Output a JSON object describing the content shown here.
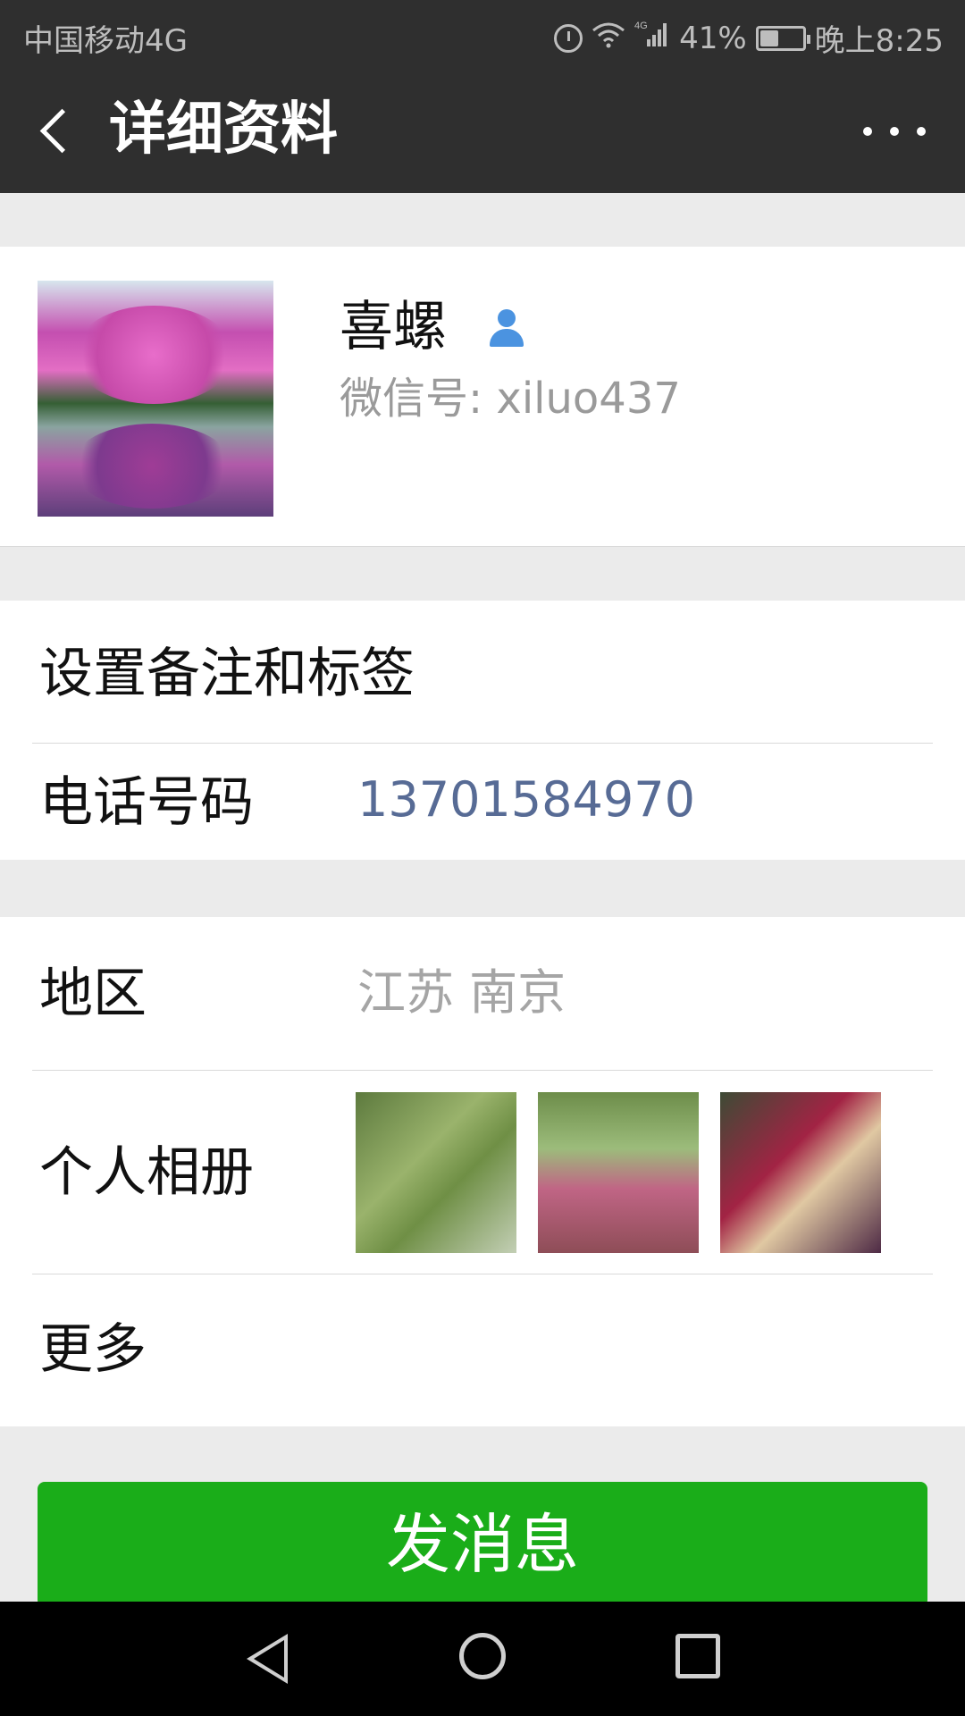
{
  "status_bar": {
    "carrier": "中国移动4G",
    "network": "4G",
    "battery": "41%",
    "battery_level": 0.41,
    "time": "晚上8:25",
    "icons": [
      "alarm-icon",
      "wifi-icon",
      "signal-icon",
      "battery-icon"
    ]
  },
  "nav": {
    "title": "详细资料",
    "back_icon": "back-icon",
    "more_icon": "more-icon"
  },
  "profile": {
    "nickname": "喜螺",
    "wechat_id_label": "微信号: xiluo437",
    "avatar_icon": "avatar",
    "contact_badge": "contact-icon"
  },
  "section1": {
    "remark_label": "设置备注和标签",
    "phone_label": "电话号码",
    "phone_value": "13701584970"
  },
  "section2": {
    "region_label": "地区",
    "region_value": "江苏  南京",
    "album_label": "个人相册",
    "more_label": "更多"
  },
  "actions": {
    "send_message": "发消息"
  },
  "colors": {
    "header": "#2f2f2f",
    "accent_green": "#1aad19",
    "link_blue": "#576b95",
    "background": "#ebebeb"
  }
}
